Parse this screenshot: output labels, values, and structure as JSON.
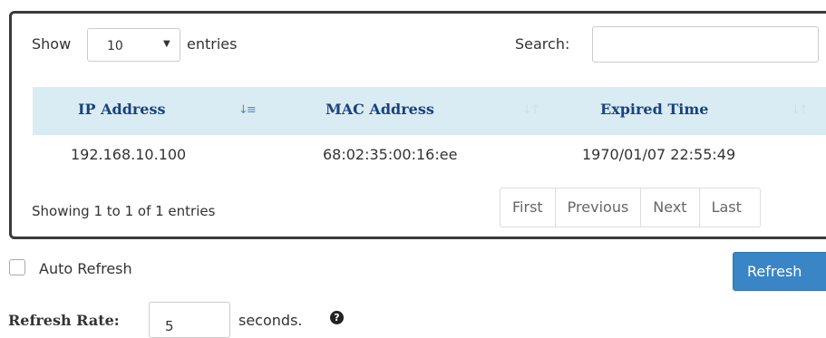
{
  "length_menu": {
    "show_label": "Show",
    "selected": "10",
    "entries_label": "entries"
  },
  "search": {
    "label": "Search:",
    "value": ""
  },
  "table": {
    "columns": [
      "IP Address",
      "MAC Address",
      "Expired Time"
    ],
    "rows": [
      [
        "192.168.10.100",
        "68:02:35:00:16:ee",
        "1970/01/07 22:55:49"
      ]
    ]
  },
  "info": "Showing 1 to 1 of 1 entries",
  "pagination": [
    "First",
    "Previous",
    "Next",
    "Last"
  ],
  "auto_refresh": {
    "label": "Auto Refresh",
    "checked": false
  },
  "refresh_button": "Refresh",
  "refresh_rate": {
    "label": "Refresh Rate:",
    "value": "5",
    "unit": "seconds."
  },
  "icons": {
    "sort_active": "sort-ascending-icon",
    "sort": "sort-icon",
    "help": "question-circle-icon",
    "dropdown": "caret-down-icon"
  },
  "colors": {
    "header_bg": "#d9ecf3",
    "header_text": "#1a4280",
    "button": "#3a85c6"
  }
}
